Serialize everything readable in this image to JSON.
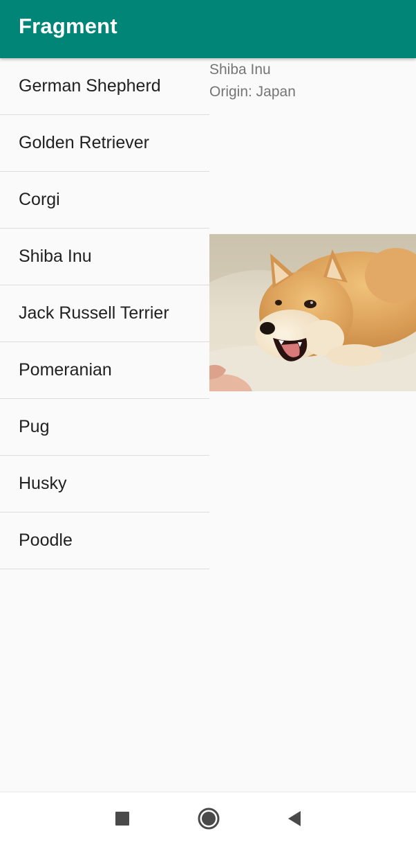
{
  "toolbar": {
    "title": "Fragment",
    "color": "#008577"
  },
  "breeds": [
    "German Shepherd",
    "Golden Retriever",
    "Corgi",
    "Shiba Inu",
    "Jack Russell Terrier",
    "Pomeranian",
    "Pug",
    "Husky",
    "Poodle"
  ],
  "detail": {
    "name": "Shiba Inu",
    "origin": "Origin: Japan",
    "image_icon": "shiba-inu-photo"
  },
  "nav": {
    "recents_icon": "square-icon",
    "home_icon": "circle-icon",
    "back_icon": "triangle-back-icon"
  }
}
